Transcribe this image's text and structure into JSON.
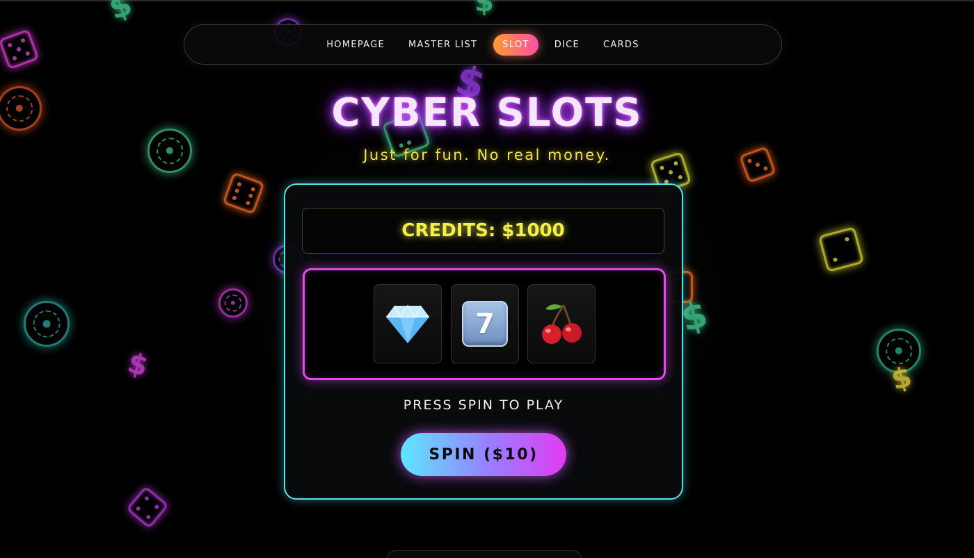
{
  "nav": {
    "items": [
      {
        "label": "HOMEPAGE",
        "active": false
      },
      {
        "label": "MASTER LIST",
        "active": false
      },
      {
        "label": "SLOT",
        "active": true
      },
      {
        "label": "DICE",
        "active": false
      },
      {
        "label": "CARDS",
        "active": false
      }
    ]
  },
  "header": {
    "title": "CYBER SLOTS",
    "subtitle": "Just for fun. No real money."
  },
  "machine": {
    "credits_label": "CREDITS: $1000",
    "reels": [
      {
        "symbol": "diamond-icon"
      },
      {
        "symbol": "seven-icon",
        "text": "7"
      },
      {
        "symbol": "cherries-icon"
      }
    ],
    "status": "PRESS SPIN TO PLAY",
    "spin_label": "SPIN ($10)"
  },
  "decor": {
    "dollar_glyph": "$"
  },
  "colors": {
    "title_glow": "#b83cff",
    "subtitle": "#f5e342",
    "credits": "#f3ee4a",
    "machine_border": "#5fe0e6",
    "reels_border": "#e24bef",
    "active_tab_start": "#ff9b2f",
    "active_tab_end": "#ff4fa8",
    "spin_start": "#5de6ff",
    "spin_end": "#e13cf0"
  }
}
